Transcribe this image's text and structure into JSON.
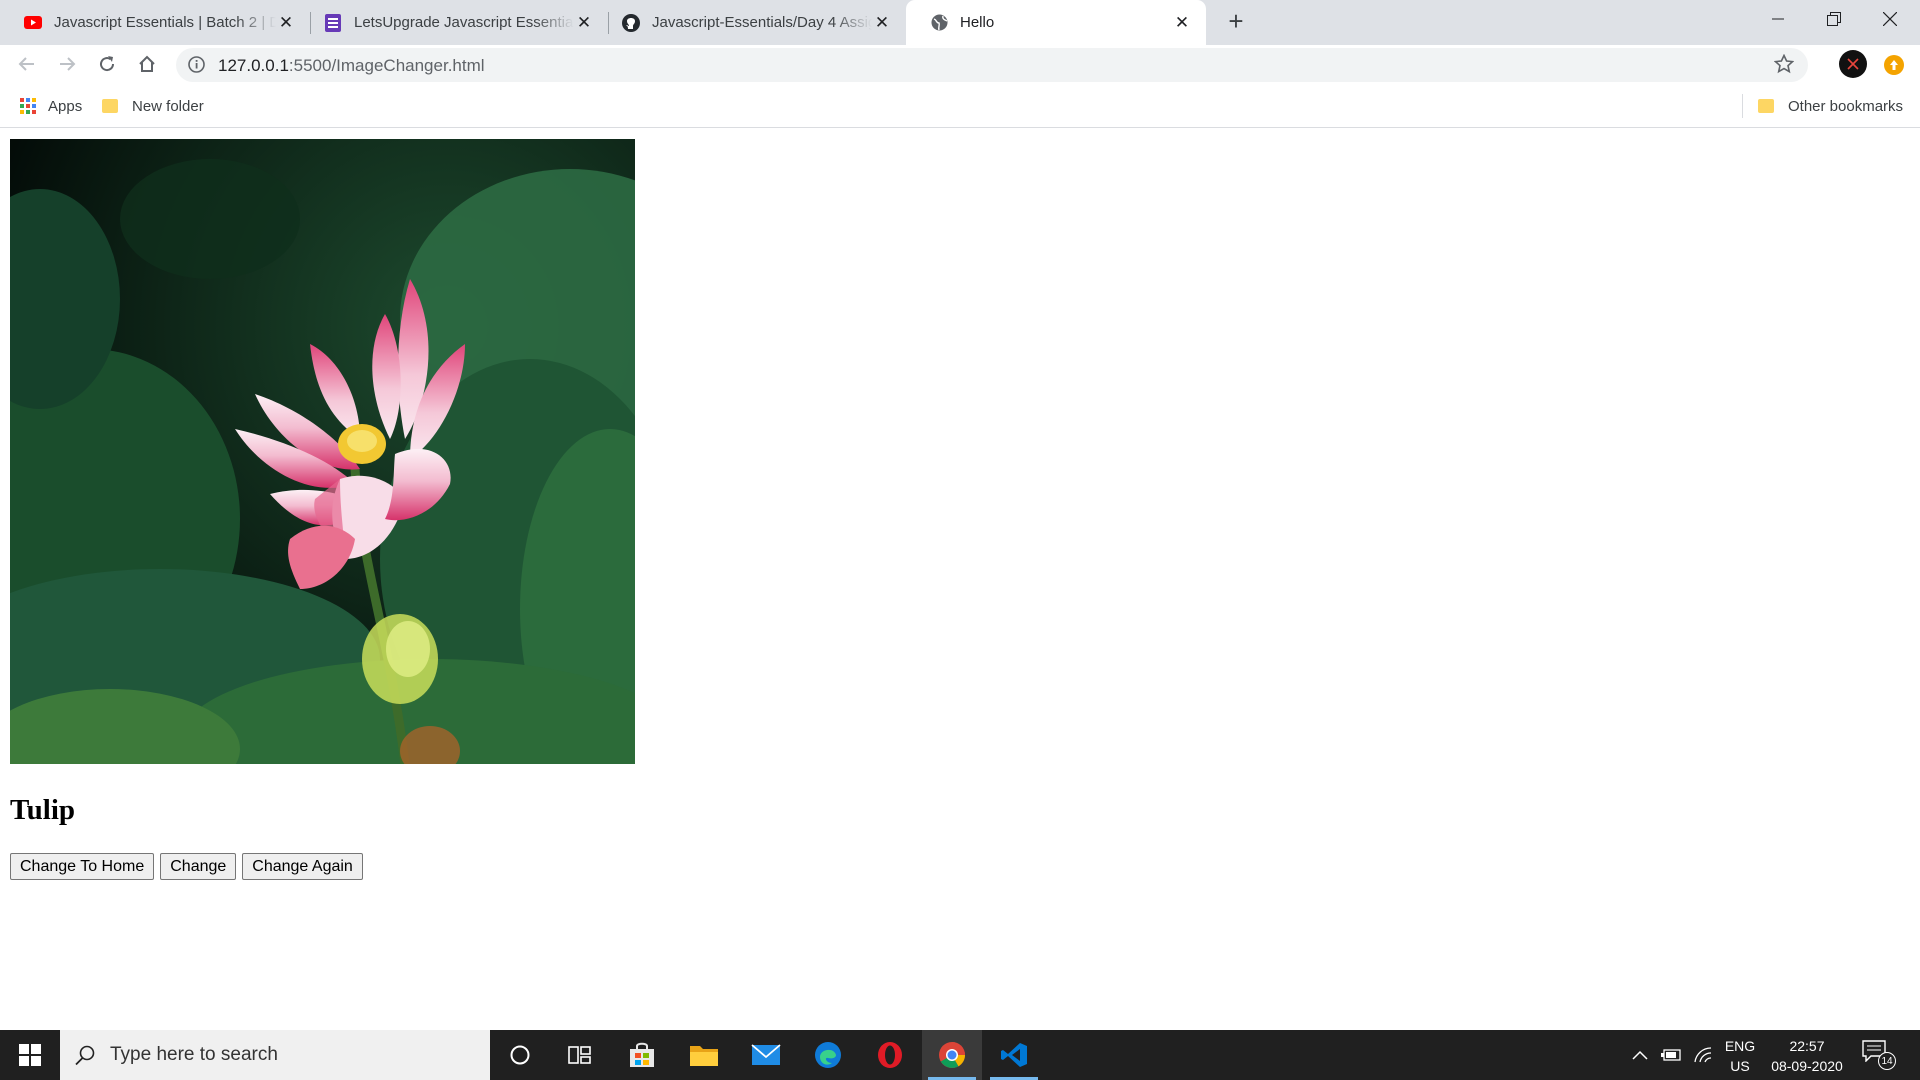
{
  "browser": {
    "tabs": [
      {
        "title": "Javascript Essentials | Batch 2 | Day",
        "favicon": "youtube-icon",
        "active": false
      },
      {
        "title": "LetsUpgrade Javascript Essentials",
        "favicon": "forms-icon",
        "active": false
      },
      {
        "title": "Javascript-Essentials/Day 4 Assignment",
        "favicon": "github-icon",
        "active": false
      },
      {
        "title": "Hello",
        "favicon": "globe-icon",
        "active": true
      }
    ],
    "new_tab_symbol": "+",
    "url_host": "127.0.0.1",
    "url_rest": ":5500/ImageChanger.html",
    "bookmarks": {
      "apps": "Apps",
      "new_folder": "New folder",
      "other": "Other bookmarks"
    },
    "accent": "#1a73e8"
  },
  "page": {
    "image_subject": "pink lotus flower on dark green leaves",
    "heading": "Tulip",
    "buttons": {
      "home": "Change To Home",
      "change": "Change",
      "again": "Change Again"
    }
  },
  "taskbar": {
    "search_placeholder": "Type here to search",
    "apps": [
      "cortana-icon",
      "task-view-icon",
      "store-icon",
      "file-explorer-icon",
      "mail-icon",
      "edge-icon",
      "opera-icon",
      "chrome-icon",
      "vscode-icon"
    ],
    "lang_top": "ENG",
    "lang_bottom": "US",
    "time": "22:57",
    "date": "08-09-2020",
    "notifications": "14"
  }
}
